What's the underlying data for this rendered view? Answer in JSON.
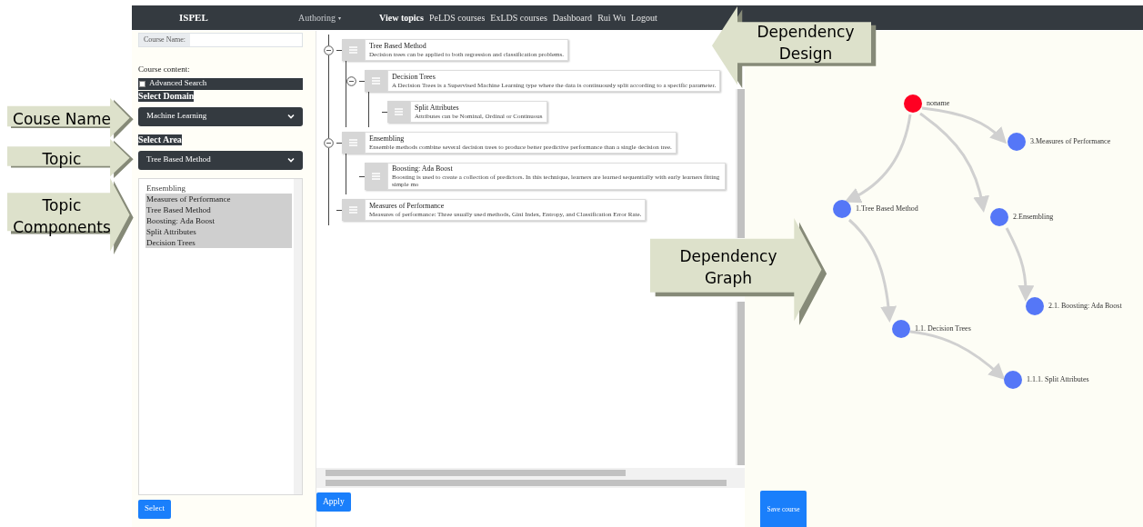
{
  "navbar": {
    "brand": "ISPEL",
    "items": [
      {
        "label": "Authoring",
        "kind": "dropdown",
        "caret": "▾"
      },
      {
        "label": "View topics",
        "kind": "bold"
      },
      {
        "label": "PeLDS courses",
        "kind": "link"
      },
      {
        "label": "ExLDS courses",
        "kind": "link"
      },
      {
        "label": "Dashboard",
        "kind": "link"
      },
      {
        "label": "Rui Wu",
        "kind": "link"
      },
      {
        "label": "Logout",
        "kind": "link"
      }
    ]
  },
  "left_panel": {
    "course_name_label": "Course Name:",
    "course_content_label": "Course content:",
    "advanced_search": {
      "label": "Advanced Search",
      "checked": false
    },
    "domain": {
      "label": "Select Domain",
      "value": "Machine Learning"
    },
    "area": {
      "label": "Select Area",
      "value": "Tree Based Method"
    },
    "components": [
      {
        "label": "Ensembling",
        "selected": false
      },
      {
        "label": "Measures of Performance",
        "selected": true
      },
      {
        "label": "Tree Based Method",
        "selected": true
      },
      {
        "label": "Boosting: Ada Boost",
        "selected": true
      },
      {
        "label": "Split Attributes",
        "selected": true
      },
      {
        "label": "Decision Trees",
        "selected": true
      }
    ],
    "select_button": "Select"
  },
  "tree": {
    "nodes": [
      {
        "title": "Tree Based Method",
        "description": "Decision trees can be applied to both regression and classification problems.",
        "expanded": true,
        "children": [
          {
            "title": "Decision Trees",
            "description": "A Decision Trees is a Supervised Machine Learning type where the data is continuously split according to a specific parameter.",
            "expanded": true,
            "children": [
              {
                "title": "Split Attributes",
                "description": "Attributes can be Nominal, Ordinal or Continuous"
              }
            ]
          }
        ]
      },
      {
        "title": "Ensembling",
        "description": "Ensemble methods combine several decision trees to produce better predictive performance than a single decision tree.",
        "expanded": true,
        "children": [
          {
            "title": "Boosting: Ada Boost",
            "description": "Boosting is used to create a collection of predictors. In this technique, learners are learned sequentially with early learners fitting simple mo"
          }
        ]
      },
      {
        "title": "Measures of Performance",
        "description": "Measures of performance: Three usually used methods, Gini Index, Entropy, and Classification Error Rate."
      }
    ],
    "apply_button": "Apply"
  },
  "graph": {
    "nodes": [
      {
        "label": "noname",
        "color": "#ff0022"
      },
      {
        "label": "3.Measures of Performance",
        "color": "#5577f7"
      },
      {
        "label": "1.Tree Based Method",
        "color": "#5577f7"
      },
      {
        "label": "2.Ensembling",
        "color": "#5577f7"
      },
      {
        "label": "2.1. Boosting: Ada Boost",
        "color": "#5577f7"
      },
      {
        "label": "1.1. Decision Trees",
        "color": "#5577f7"
      },
      {
        "label": "1.1.1. Split Attributes",
        "color": "#5577f7"
      }
    ],
    "save_button": "Save course"
  },
  "callouts": [
    {
      "text": "Couse Name",
      "kind": "rightarrow"
    },
    {
      "text": "Topic",
      "kind": "rightarrow"
    },
    {
      "text": "Topic Components",
      "kind": "rightarrow"
    },
    {
      "text": "Dependency Design",
      "kind": "leftarrow"
    },
    {
      "text": "Dependency Graph",
      "kind": "rightarrow"
    }
  ]
}
